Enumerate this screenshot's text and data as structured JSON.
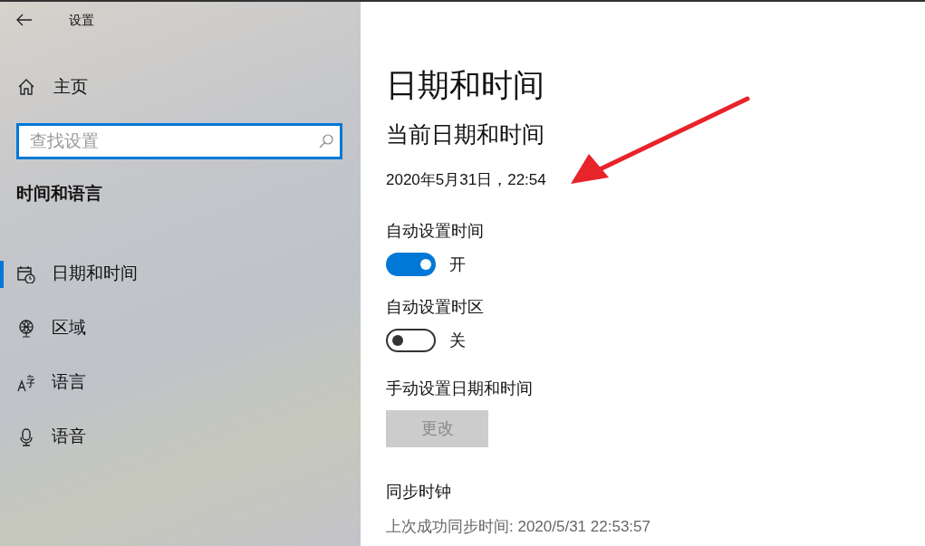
{
  "window": {
    "title": "设置"
  },
  "sidebar": {
    "home": "主页",
    "search": {
      "placeholder": "查找设置"
    },
    "section": "时间和语言",
    "items": [
      {
        "label": "日期和时间",
        "kind": "calendar",
        "selected": true
      },
      {
        "label": "区域",
        "kind": "globe",
        "selected": false
      },
      {
        "label": "语言",
        "kind": "language",
        "selected": false
      },
      {
        "label": "语音",
        "kind": "microphone",
        "selected": false
      }
    ]
  },
  "content": {
    "title": "日期和时间",
    "subtitle": "当前日期和时间",
    "current": "2020年5月31日，22:54",
    "settings": [
      {
        "label": "自动设置时间",
        "on": true,
        "state_text": "开"
      },
      {
        "label": "自动设置时区",
        "on": false,
        "state_text": "关"
      }
    ],
    "manual": {
      "label": "手动设置日期和时间",
      "button": {
        "label": "更改",
        "disabled": true
      }
    },
    "sync": {
      "heading": "同步时钟",
      "last_sync": "上次成功同步时间: 2020/5/31 22:53:57"
    }
  }
}
